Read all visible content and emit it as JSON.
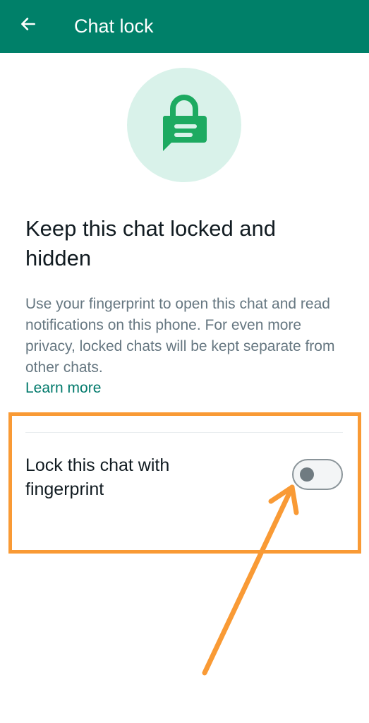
{
  "appbar": {
    "title": "Chat lock",
    "back_icon": "arrow-left-icon",
    "color": "#008069"
  },
  "hero": {
    "icon": "lock-chat-icon",
    "icon_color": "#1daa61",
    "circle_color": "#d9f2ea"
  },
  "content": {
    "headline": "Keep this chat locked and hidden",
    "description": "Use your fingerprint to open this chat and read notifications on this phone. For even more privacy, locked chats will be kept separate from other chats.",
    "learn_more": "Learn more"
  },
  "setting": {
    "label": "Lock this chat with fingerprint",
    "toggle_on": false
  },
  "annotation": {
    "highlight_color": "#f99a35",
    "arrow_icon": "arrow-annotation-icon"
  }
}
